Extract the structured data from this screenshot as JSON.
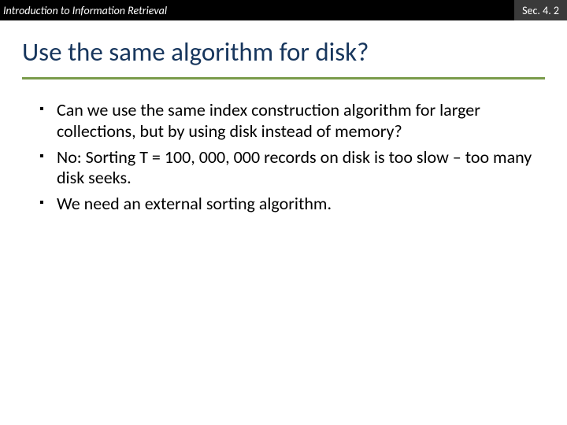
{
  "header": {
    "course": "Introduction to Information Retrieval",
    "section": "Sec. 4. 2"
  },
  "title": "Use the same algorithm for disk?",
  "bullets": [
    "Can we use the same index construction algorithm for larger collections, but by using disk instead of memory?",
    "No: Sorting T = 100, 000, 000 records on disk is too slow – too many disk seeks.",
    "We need an external sorting algorithm."
  ]
}
